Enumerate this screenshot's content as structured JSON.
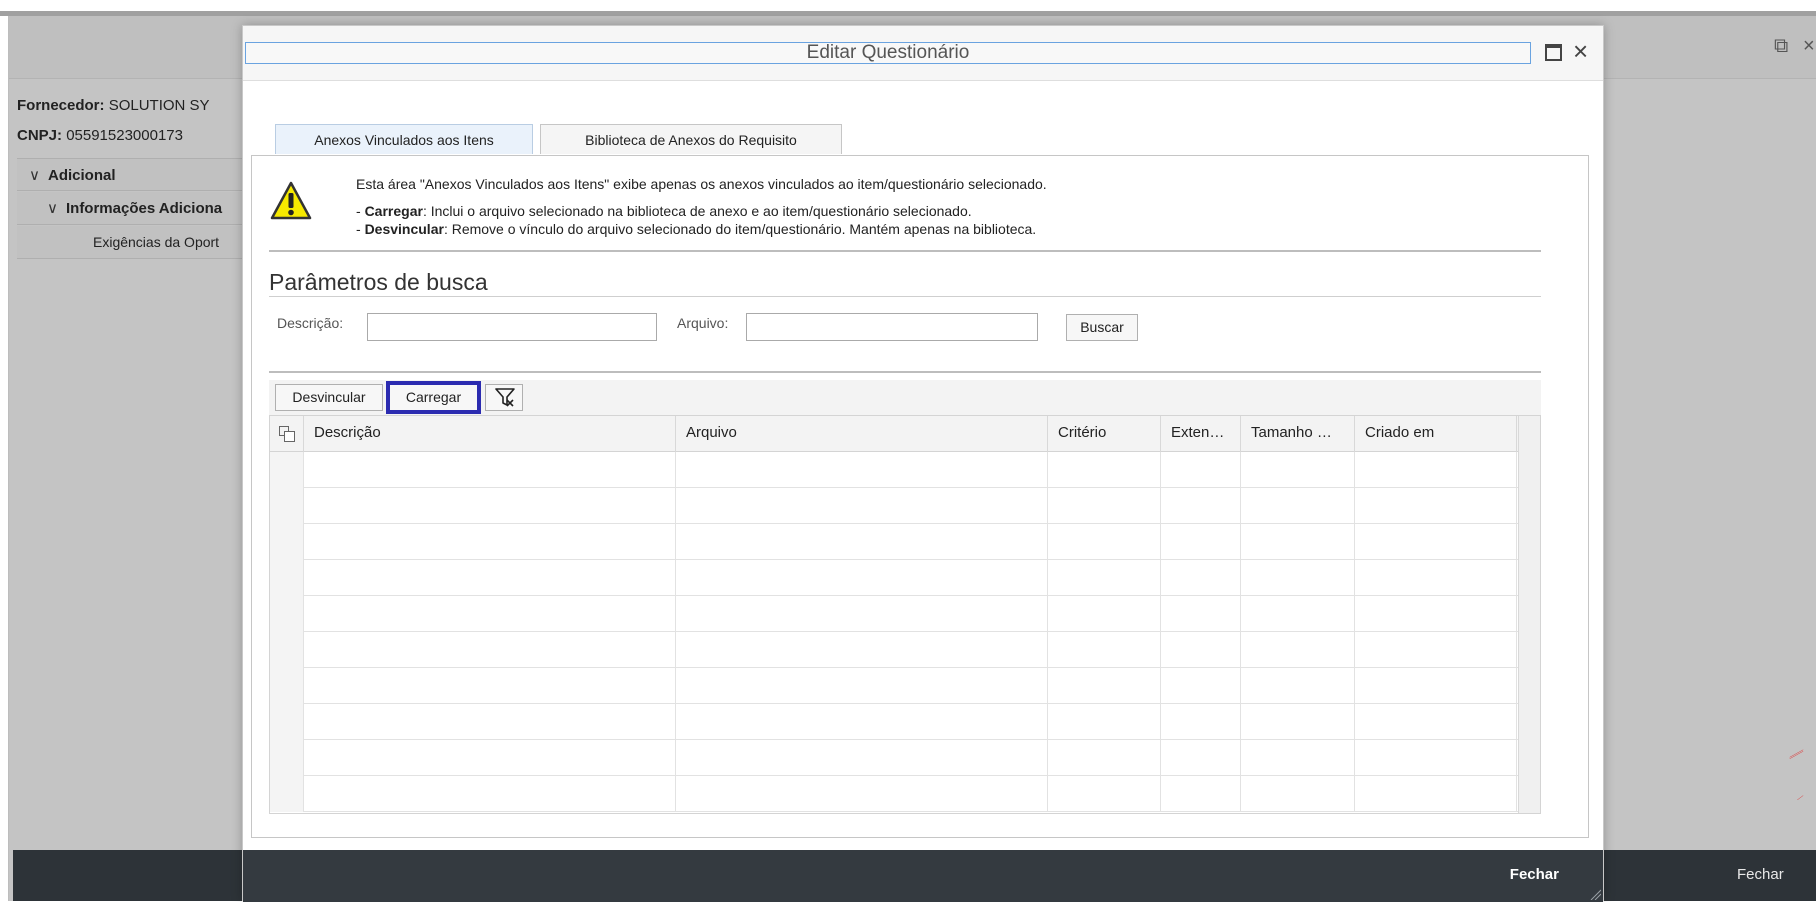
{
  "background": {
    "supplier_label": "Fornecedor:",
    "supplier_value": "SOLUTION SY",
    "cnpj_label": "CNPJ:",
    "cnpj_value": "05591523000173",
    "tree": [
      {
        "label": "Adicional"
      },
      {
        "label": "Informações Adiciona"
      },
      {
        "label": "Exigências da Oport"
      }
    ],
    "footer_close_label": "Fechar"
  },
  "dialog": {
    "title": "Editar Questionário",
    "tabs": [
      {
        "label": "Anexos Vinculados aos Itens",
        "active": true
      },
      {
        "label": "Biblioteca de Anexos do Requisito",
        "active": false
      }
    ],
    "info": {
      "line1": "Esta área \"Anexos Vinculados aos Itens\" exibe apenas os anexos vinculados ao item/questionário selecionado.",
      "line2_bold": "Carregar",
      "line2_rest": ": Inclui o arquivo selecionado na biblioteca de anexo e ao item/questionário selecionado.",
      "line3_bold": "Desvincular",
      "line3_rest": ": Remove o vínculo do arquivo selecionado do item/questionário. Mantém apenas na biblioteca.",
      "dash": "- "
    },
    "search": {
      "title": "Parâmetros de busca",
      "description_label": "Descrição:",
      "description_value": "",
      "file_label": "Arquivo:",
      "file_value": "",
      "search_button": "Buscar"
    },
    "toolbar": {
      "unlink_button": "Desvincular",
      "upload_button": "Carregar"
    },
    "table": {
      "columns": [
        "Descrição",
        "Arquivo",
        "Critério",
        "Exten…",
        "Tamanho …",
        "Criado em"
      ],
      "rows": [
        [],
        [],
        [],
        [],
        [],
        [],
        [],
        [],
        [],
        []
      ]
    },
    "footer_close_label": "Fechar"
  },
  "colors": {
    "highlight_border": "#2b2bb0",
    "footer_bg": "#343a40",
    "tab_active_bg": "#eaf2fb"
  }
}
